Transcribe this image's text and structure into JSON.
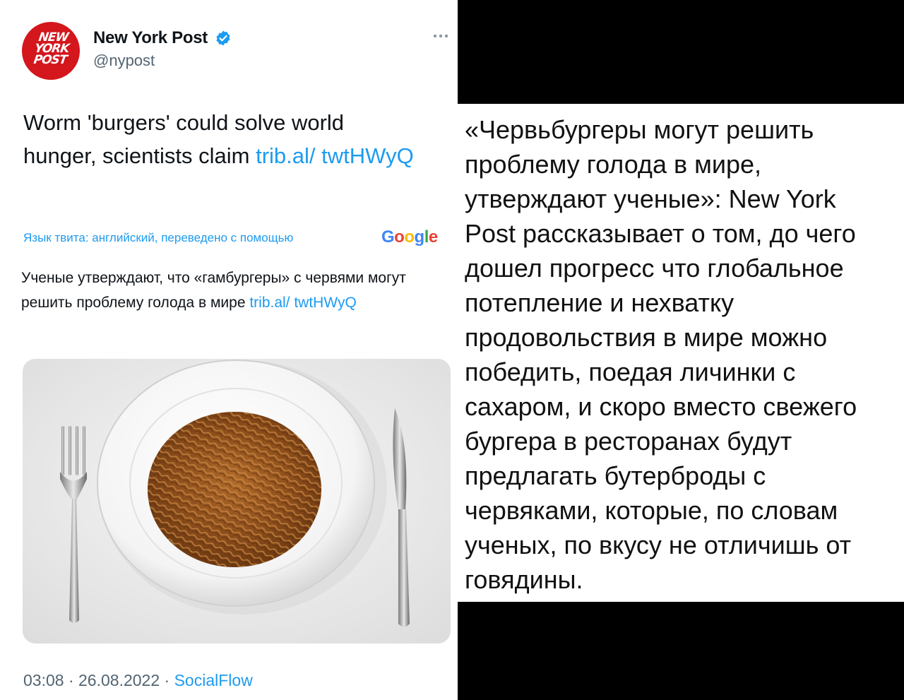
{
  "tweet": {
    "avatar": {
      "logo_lines": [
        "NEW",
        "YORK",
        "POST"
      ],
      "color": "#d4161d"
    },
    "author_name": "New York Post",
    "verified_icon": "verified-badge-icon",
    "handle": "@nypost",
    "more_icon": "more-horizontal-icon",
    "text": "Worm 'burgers' could solve world hunger, scientists claim ",
    "link_text": "trib.al/ twtHWyQ",
    "translation_note": "Язык твита: английский, переведено с помощью",
    "google_logo": [
      "G",
      "o",
      "o",
      "g",
      "l",
      "e"
    ],
    "translated_text": "Ученые утверждают, что «гамбургеры» с червями могут решить проблему голода в мире ",
    "translated_link": "trib.al/ twtHWyQ",
    "image_alt": "plate of mealworms with fork and knife",
    "time": "03:08",
    "separator": " · ",
    "date": "26.08.2022",
    "source": "SocialFlow"
  },
  "caption": {
    "text": "«Червьбургеры могут решить проблему голода в мире, утверждают ученые»: New York Post рассказывает о том, до чего дошел прогресс что глобальное потепление и нехватку продовольствия в мире можно победить, поедая личинки с сахаром, и скоро вместо свежего бургера в ресторанах будут предлагать бутерброды с червяками, которые, по словам ученых, по вкусу не отличишь от говядины."
  },
  "colors": {
    "link": "#1d9bf0",
    "verified": "#1d9bf0",
    "brand": "#d4161d",
    "muted": "#536471"
  }
}
